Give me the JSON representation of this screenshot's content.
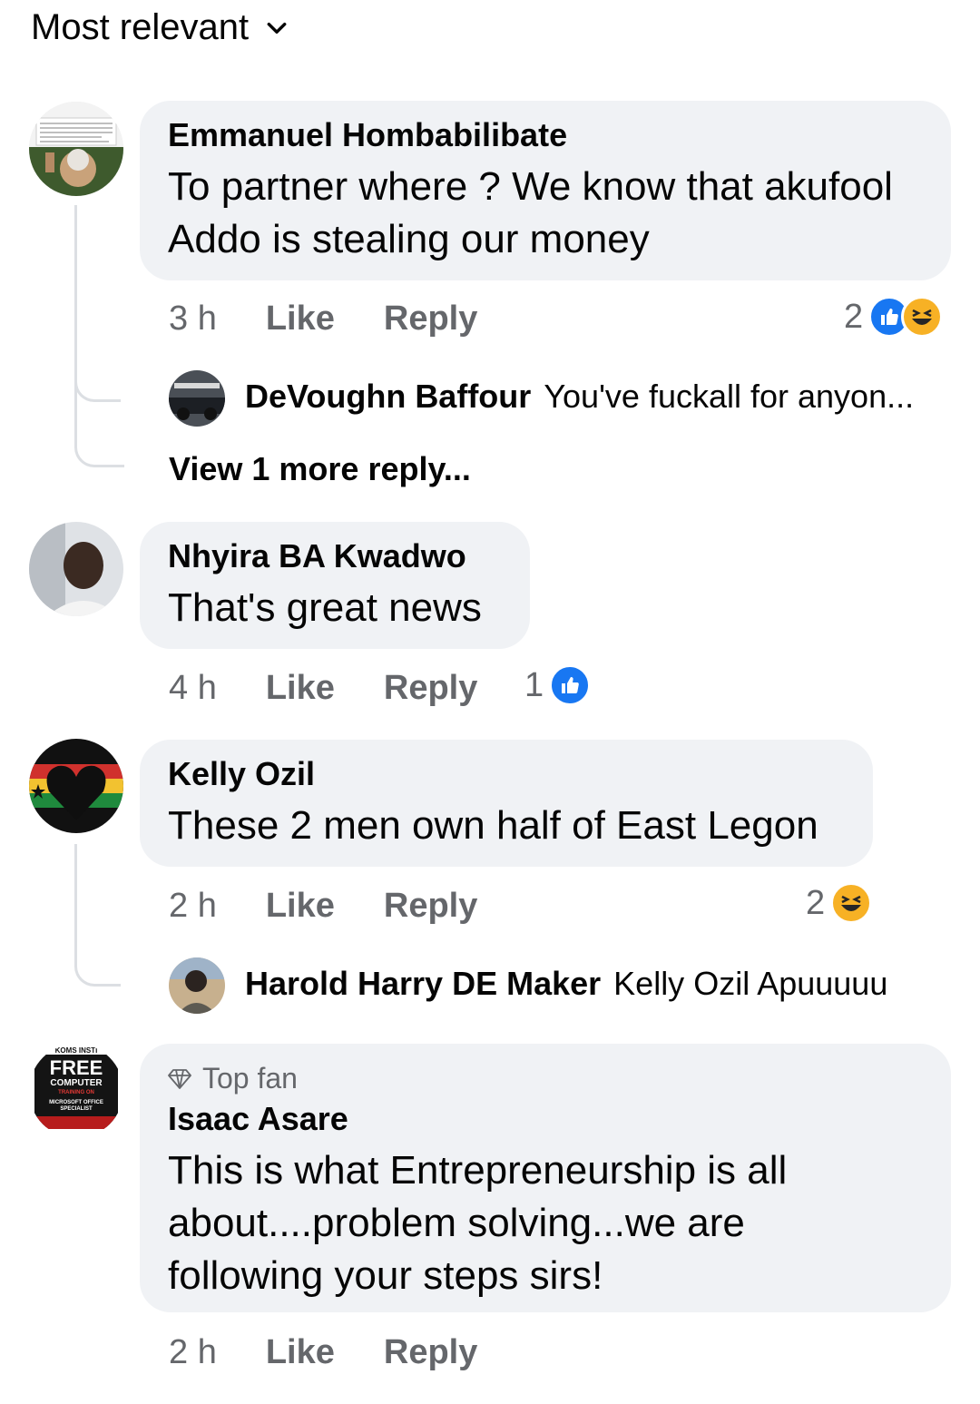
{
  "sort": {
    "label": "Most relevant"
  },
  "comments": [
    {
      "author": "Emmanuel Hombabilibate",
      "text_lines": [
        "To partner where ? We know that akufool",
        "Addo is stealing our money"
      ],
      "time": "3 h",
      "like": "Like",
      "reply": "Reply",
      "reaction_count": "2",
      "reactions": [
        "like-icon",
        "haha-icon"
      ],
      "replies": [
        {
          "author": "DeVoughn Baffour",
          "text": "You've fuckall for anyon..."
        }
      ],
      "view_more": "View 1 more reply..."
    },
    {
      "author": "Nhyira BA Kwadwo",
      "text_lines": [
        "That's great news"
      ],
      "time": "4 h",
      "like": "Like",
      "reply": "Reply",
      "reaction_count": "1",
      "reactions": [
        "like-icon"
      ]
    },
    {
      "author": "Kelly Ozil",
      "text_lines": [
        "These 2 men own half of East Legon"
      ],
      "time": "2 h",
      "like": "Like",
      "reply": "Reply",
      "reaction_count": "2",
      "reactions": [
        "haha-icon"
      ],
      "replies": [
        {
          "author": "Harold Harry DE Maker",
          "text": "Kelly Ozil Apuuuuu"
        }
      ]
    },
    {
      "badge": "Top fan",
      "author": "Isaac Asare",
      "text_lines": [
        "This is what Entrepreneurship is all",
        "about....problem solving...we are",
        "following your steps sirs!"
      ],
      "time": "2 h",
      "like": "Like",
      "reply": "Reply"
    }
  ],
  "avatar_4_text": {
    "top": "KOMS INSTI",
    "big": "FREE",
    "mid": "COMPUTER",
    "sub": "TRAINING ON",
    "sub2": "MICROSOFT OFFICE",
    "sub3": "SPECIALIST"
  },
  "colors": {
    "like_blue": "#1877f2",
    "haha_yellow": "#f7b125",
    "bubble": "#f0f2f5",
    "meta_gray": "#65676b"
  }
}
